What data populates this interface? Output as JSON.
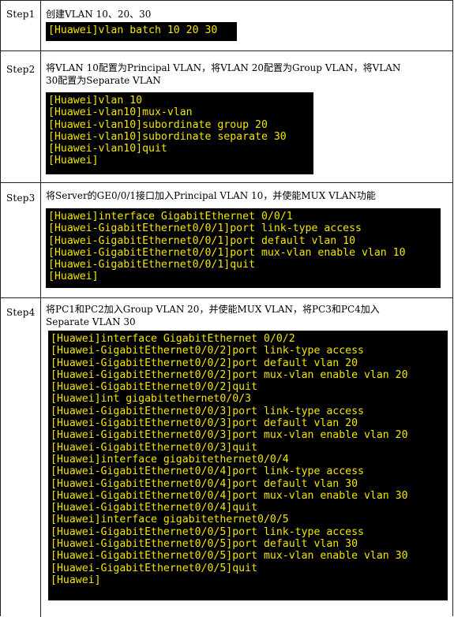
{
  "steps": [
    {
      "label": "Step1",
      "description": "创建VLAN 10、20、30",
      "commands": [
        "[Huawei]vlan batch 10 20 30"
      ]
    },
    {
      "label": "Step2",
      "description": "将VLAN 10配置为Principal VLAN，将VLAN 20配置为Group VLAN，将VLAN\n30配置为Separate VLAN",
      "commands": [
        "[Huawei]vlan 10",
        "[Huawei-vlan10]mux-vlan",
        "[Huawei-vlan10]subordinate group 20",
        "[Huawei-vlan10]subordinate separate 30",
        "[Huawei-vlan10]quit",
        "[Huawei]"
      ]
    },
    {
      "label": "Step3",
      "description": "将Server的GE0/0/1接口加入Principal VLAN 10，并使能MUX VLAN功能",
      "commands": [
        "[Huawei]interface GigabitEthernet 0/0/1",
        "[Huawei-GigabitEthernet0/0/1]port link-type access",
        "[Huawei-GigabitEthernet0/0/1]port default vlan 10",
        "[Huawei-GigabitEthernet0/0/1]port mux-vlan enable vlan 10",
        "[Huawei-GigabitEthernet0/0/1]quit",
        "[Huawei]"
      ]
    },
    {
      "label": "Step4",
      "description": "将PC1和PC2加入Group VLAN 20，并使能MUX VLAN，将PC3和PC4加入\nSeparate VLAN 30",
      "commands": [
        "[Huawei]interface GigabitEthernet 0/0/2",
        "[Huawei-GigabitEthernet0/0/2]port link-type access",
        "[Huawei-GigabitEthernet0/0/2]port default vlan 20",
        "[Huawei-GigabitEthernet0/0/2]port mux-vlan enable vlan 20",
        "[Huawei-GigabitEthernet0/0/2]quit",
        "[Huawei]int gigabitethernet0/0/3",
        "[Huawei-GigabitEthernet0/0/3]port link-type access",
        "[Huawei-GigabitEthernet0/0/3]port default vlan 20",
        "[Huawei-GigabitEthernet0/0/3]port mux-vlan enable vlan 20",
        "[Huawei-GigabitEthernet0/0/3]quit",
        "[Huawei]interface gigabitethernet0/0/4",
        "[Huawei-GigabitEthernet0/0/4]port link-type access",
        "[Huawei-GigabitEthernet0/0/4]port default vlan 30",
        "[Huawei-GigabitEthernet0/0/4]port mux-vlan enable vlan 30",
        "[Huawei-GigabitEthernet0/0/4]quit",
        "[Huawei]interface gigabitethernet0/0/5",
        "[Huawei-GigabitEthernet0/0/5]port link-type access",
        "[Huawei-GigabitEthernet0/0/5]port default vlan 30",
        "[Huawei-GigabitEthernet0/0/5]port mux-vlan enable vlan 30",
        "[Huawei-GigabitEthernet0/0/5]quit",
        "[Huawei]"
      ]
    }
  ],
  "colors": {
    "terminal_bg": "#000000",
    "terminal_text": "#f2e600",
    "border": "#222222"
  }
}
